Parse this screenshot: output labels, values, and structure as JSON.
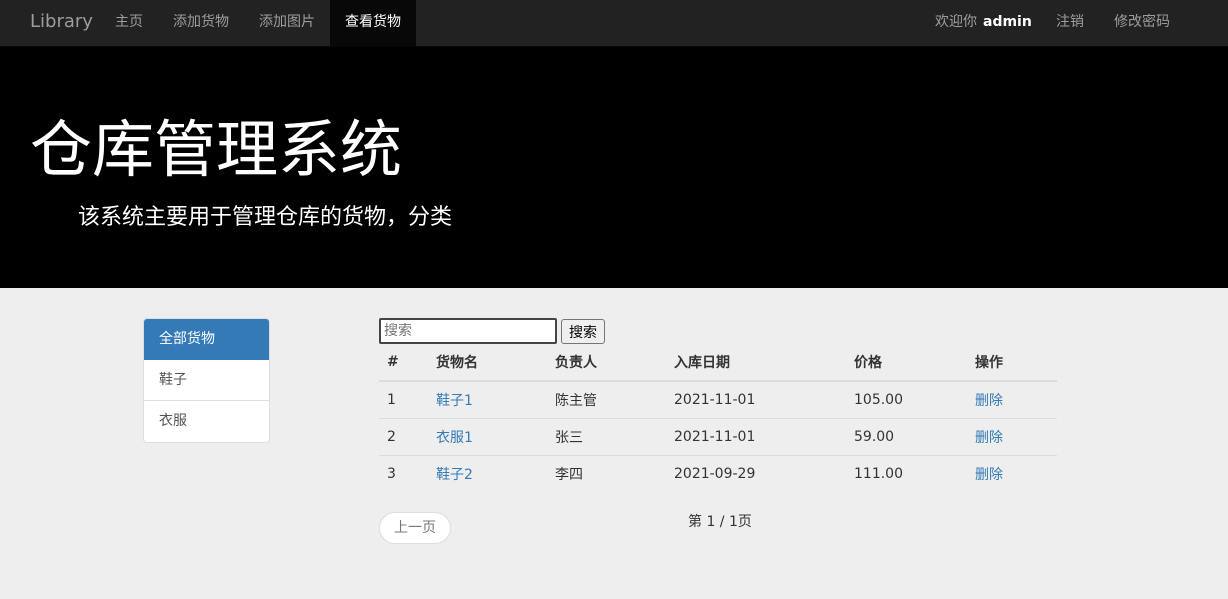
{
  "navbar": {
    "brand": "Library",
    "items": [
      {
        "label": "主页"
      },
      {
        "label": "添加货物"
      },
      {
        "label": "添加图片"
      },
      {
        "label": "查看货物"
      }
    ],
    "welcome_label": "欢迎你",
    "username": "admin",
    "logout": "注销",
    "change_password": "修改密码"
  },
  "jumbotron": {
    "title": "仓库管理系统",
    "subtitle": "该系统主要用于管理仓库的货物，分类"
  },
  "sidebar": {
    "items": [
      {
        "label": "全部货物"
      },
      {
        "label": "鞋子"
      },
      {
        "label": "衣服"
      }
    ]
  },
  "search": {
    "placeholder": "搜索",
    "button_label": "搜索"
  },
  "table": {
    "headers": [
      "#",
      "货物名",
      "负责人",
      "入库日期",
      "价格",
      "操作"
    ],
    "rows": [
      {
        "id": "1",
        "name": "鞋子1",
        "owner": "陈主管",
        "date": "2021-11-01",
        "price": "105.00",
        "action": "删除"
      },
      {
        "id": "2",
        "name": "衣服1",
        "owner": "张三",
        "date": "2021-11-01",
        "price": "59.00",
        "action": "删除"
      },
      {
        "id": "3",
        "name": "鞋子2",
        "owner": "李四",
        "date": "2021-09-29",
        "price": "111.00",
        "action": "删除"
      }
    ]
  },
  "pager": {
    "prev_label": "上一页",
    "page_info": "第 1 / 1页"
  },
  "colors": {
    "navbar_bg": "#222222",
    "active_nav_bg": "#080808",
    "jumbotron_bg": "#000000",
    "page_bg": "#eeeeee",
    "accent": "#337ab7"
  }
}
